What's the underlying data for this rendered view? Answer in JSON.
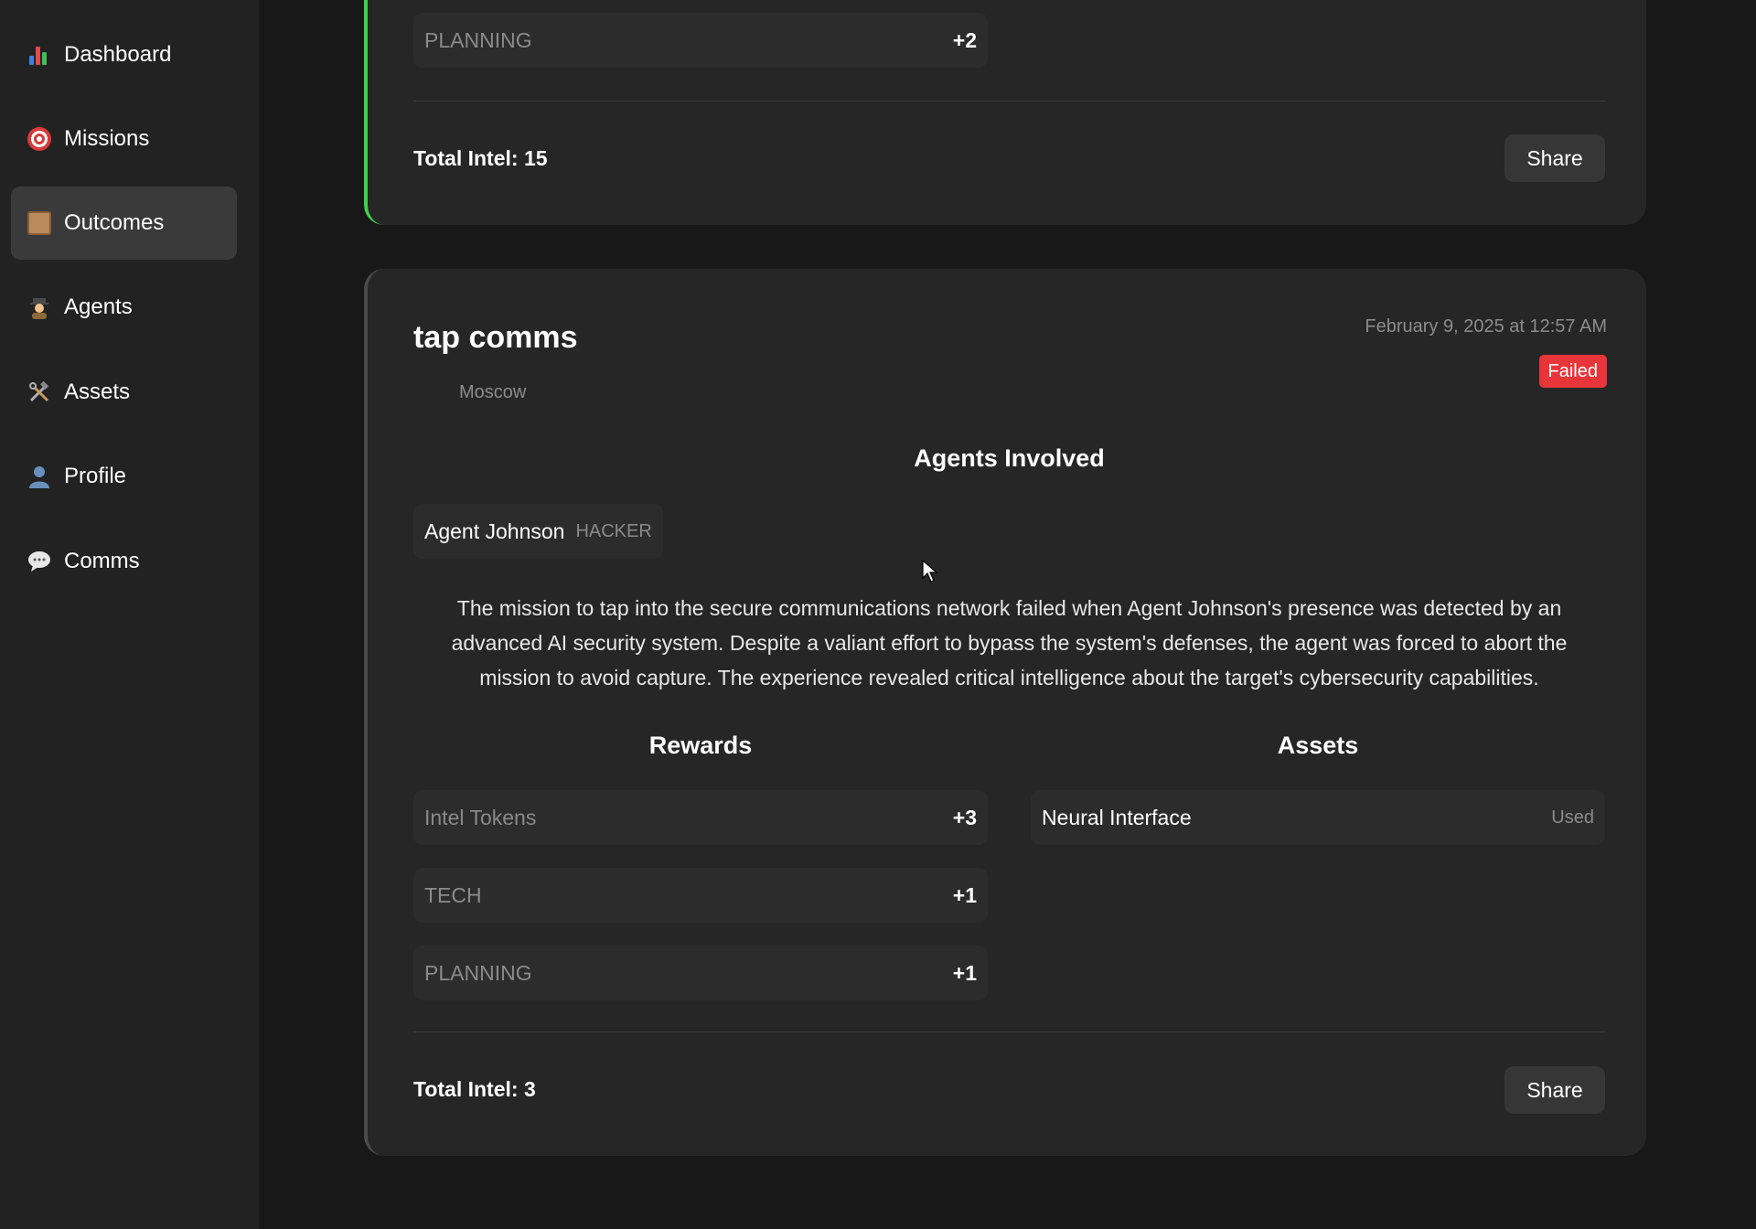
{
  "sidebar": {
    "items": [
      {
        "label": "Dashboard",
        "icon": "bar-chart-icon"
      },
      {
        "label": "Missions",
        "icon": "target-icon"
      },
      {
        "label": "Outcomes",
        "icon": "scroll-icon",
        "active": true
      },
      {
        "label": "Agents",
        "icon": "detective-icon"
      },
      {
        "label": "Assets",
        "icon": "tools-icon"
      },
      {
        "label": "Profile",
        "icon": "user-icon"
      },
      {
        "label": "Comms",
        "icon": "speech-bubble-icon"
      }
    ]
  },
  "prev_card": {
    "reward_label": "PLANNING",
    "reward_value": "+2",
    "total_intel": "Total Intel: 15",
    "share_label": "Share",
    "accent_color": "#3ed34a"
  },
  "card": {
    "title": "tap comms",
    "location": "Moscow",
    "date": "February 9, 2025 at 12:57 AM",
    "status": "Failed",
    "status_color": "#e8353a",
    "agents_heading": "Agents Involved",
    "agents": [
      {
        "name": "Agent Johnson",
        "role": "HACKER"
      }
    ],
    "description": "The mission to tap into the secure communications network failed when Agent Johnson's presence was detected by an advanced AI security system. Despite a valiant effort to bypass the system's defenses, the agent was forced to abort the mission to avoid capture. The experience revealed critical intelligence about the target's cybersecurity capabilities.",
    "rewards_heading": "Rewards",
    "rewards": [
      {
        "label": "Intel Tokens",
        "value": "+3"
      },
      {
        "label": "TECH",
        "value": "+1"
      },
      {
        "label": "PLANNING",
        "value": "+1"
      }
    ],
    "assets_heading": "Assets",
    "assets": [
      {
        "name": "Neural Interface",
        "status": "Used"
      }
    ],
    "total_intel": "Total Intel: 3",
    "share_label": "Share"
  }
}
